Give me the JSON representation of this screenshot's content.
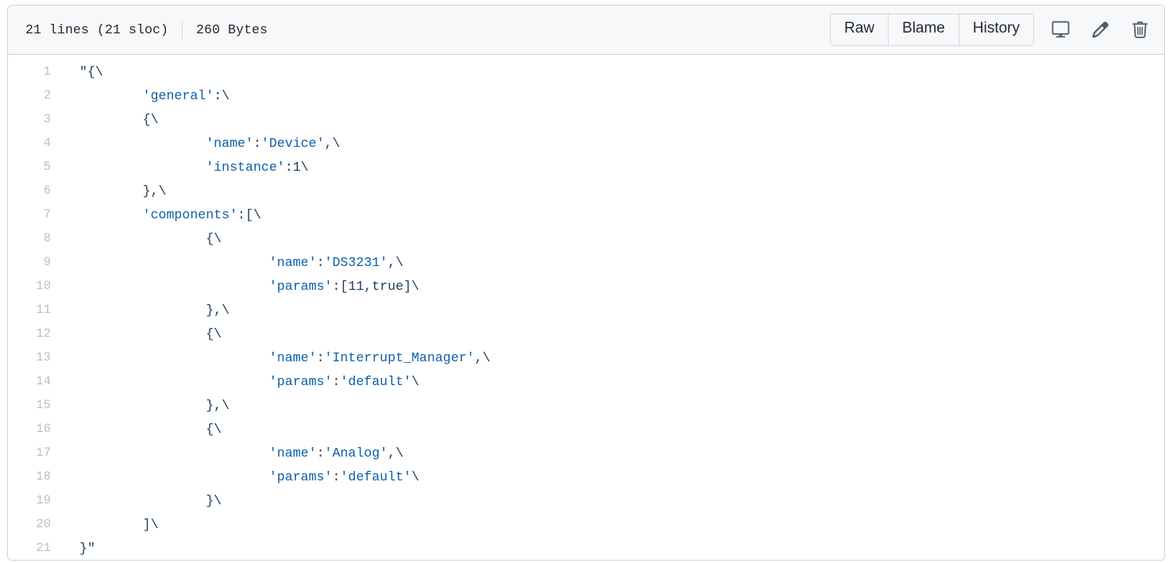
{
  "header": {
    "lines_text": "21 lines (21 sloc)",
    "size_text": "260 Bytes",
    "buttons": [
      {
        "label": "Raw",
        "name": "raw-button"
      },
      {
        "label": "Blame",
        "name": "blame-button"
      },
      {
        "label": "History",
        "name": "history-button"
      }
    ],
    "icons": [
      {
        "name": "desktop-icon",
        "title": "Open in desktop"
      },
      {
        "name": "pencil-icon",
        "title": "Edit this file"
      },
      {
        "name": "trash-icon",
        "title": "Delete this file"
      }
    ]
  },
  "colors": {
    "header_bg": "#f6f8fa",
    "border": "#d1d5da",
    "code_bg": "#ffffff",
    "line_number": "#b9bfc6",
    "string": "#0b5ea8",
    "punctuation": "#1d3a5c",
    "text": "#24292e"
  },
  "code": {
    "language": "json",
    "line_count": 21,
    "lines": [
      {
        "n": 1,
        "indent": 0,
        "text": "\"{\\"
      },
      {
        "n": 2,
        "indent": 1,
        "text": "'general':\\"
      },
      {
        "n": 3,
        "indent": 1,
        "text": "{\\"
      },
      {
        "n": 4,
        "indent": 2,
        "text": "'name':'Device',\\"
      },
      {
        "n": 5,
        "indent": 2,
        "text": "'instance':1\\"
      },
      {
        "n": 6,
        "indent": 1,
        "text": "},\\"
      },
      {
        "n": 7,
        "indent": 1,
        "text": "'components':[\\"
      },
      {
        "n": 8,
        "indent": 2,
        "text": "{\\"
      },
      {
        "n": 9,
        "indent": 3,
        "text": "'name':'DS3231',\\"
      },
      {
        "n": 10,
        "indent": 3,
        "text": "'params':[11,true]\\"
      },
      {
        "n": 11,
        "indent": 2,
        "text": "},\\"
      },
      {
        "n": 12,
        "indent": 2,
        "text": "{\\"
      },
      {
        "n": 13,
        "indent": 3,
        "text": "'name':'Interrupt_Manager',\\"
      },
      {
        "n": 14,
        "indent": 3,
        "text": "'params':'default'\\"
      },
      {
        "n": 15,
        "indent": 2,
        "text": "},\\"
      },
      {
        "n": 16,
        "indent": 2,
        "text": "{\\"
      },
      {
        "n": 17,
        "indent": 3,
        "text": "'name':'Analog',\\"
      },
      {
        "n": 18,
        "indent": 3,
        "text": "'params':'default'\\"
      },
      {
        "n": 19,
        "indent": 2,
        "text": "}\\"
      },
      {
        "n": 20,
        "indent": 1,
        "text": "]\\"
      },
      {
        "n": 21,
        "indent": 0,
        "text": "}\""
      }
    ]
  }
}
